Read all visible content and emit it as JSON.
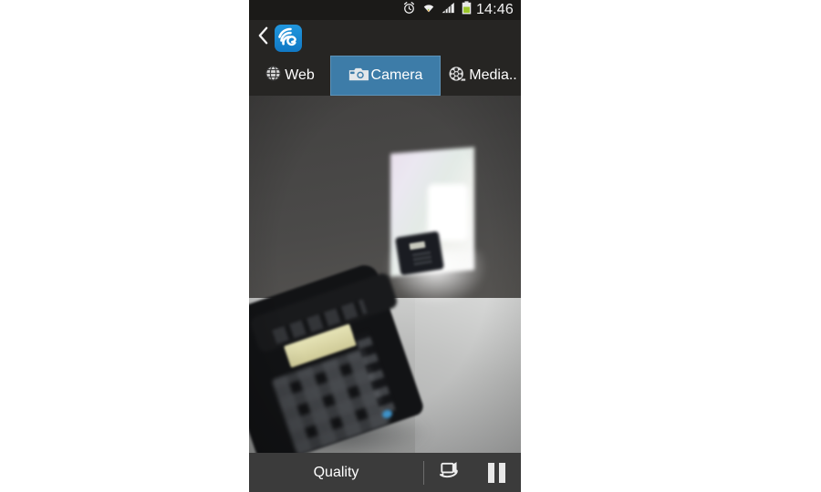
{
  "status_bar": {
    "time": "14:46",
    "icons": [
      {
        "name": "alarm-clock-icon"
      },
      {
        "name": "wifi-icon"
      },
      {
        "name": "signal-bars-icon"
      },
      {
        "name": "battery-icon"
      }
    ]
  },
  "app_bar": {
    "back_icon": "back-chevron-icon",
    "logo_icon": "app-logo-icon",
    "logo_letter": "e"
  },
  "tabs": [
    {
      "id": "web",
      "label": "Web",
      "icon": "globe-icon",
      "selected": false
    },
    {
      "id": "camera",
      "label": "Camera",
      "icon": "camera-icon",
      "selected": true
    },
    {
      "id": "media",
      "label": "Media..",
      "icon": "film-reel-icon",
      "selected": false
    }
  ],
  "viewfinder": {
    "description": "Live camera preview: dark gray office wall, bright illuminated panel/window with color fringing, a desk phone in the foreground on a light gray desk"
  },
  "bottom_bar": {
    "quality_label": "Quality",
    "switch_camera_icon": "camera-switch-icon",
    "pause_icon": "pause-icon"
  },
  "colors": {
    "accent_blue": "#3d7ca8",
    "app_bar": "#262523",
    "status_bar": "#1b1a18",
    "bottom_bar": "#3b3b3b",
    "page_background": "#ffffff",
    "battery_green": "#9ac62a"
  }
}
